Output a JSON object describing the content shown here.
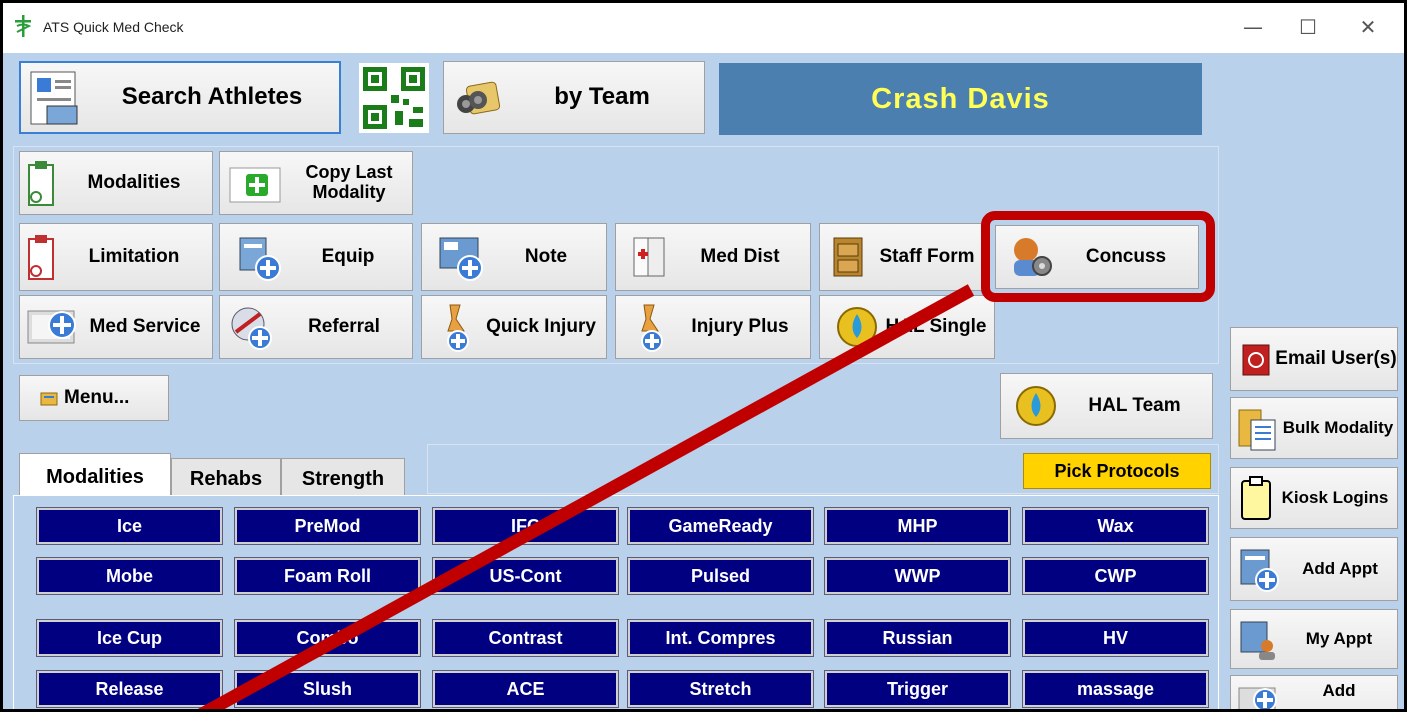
{
  "window": {
    "title": "ATS Quick Med Check",
    "minimize": "—",
    "maximize": "☐",
    "close": "✕"
  },
  "top": {
    "search_athletes": "Search Athletes",
    "by_team": "by Team",
    "athlete_name": "Crash  Davis"
  },
  "actions": {
    "modalities": "Modalities",
    "copy_last_modality": "Copy Last Modality",
    "limitation": "Limitation",
    "equip": "Equip",
    "note": "Note",
    "med_dist": "Med Dist",
    "staff_form": "Staff Form",
    "concuss": "Concuss",
    "med_service": "Med Service",
    "referral": "Referral",
    "quick_injury": "Quick Injury",
    "injury_plus": "Injury Plus",
    "hal_single": "HAL Single",
    "menu": "Menu...",
    "hal_team": "HAL Team"
  },
  "side": {
    "email_users": "Email User(s)",
    "bulk_modality": "Bulk Modality",
    "kiosk_logins": "Kiosk Logins",
    "add_appt": "Add Appt",
    "my_appt": "My Appt",
    "add": "Add"
  },
  "tabs": {
    "modalities": "Modalities",
    "rehabs": "Rehabs",
    "strength": "Strength",
    "pick_protocols": "Pick Protocols"
  },
  "grid": [
    [
      "Ice",
      "PreMod",
      "IFC",
      "GameReady",
      "MHP",
      "Wax"
    ],
    [
      "Mobe",
      "Foam Roll",
      "US-Cont",
      "Pulsed",
      "WWP",
      "CWP"
    ],
    [
      "Ice Cup",
      "Combo",
      "Contrast",
      "Int. Compres",
      "Russian",
      "HV"
    ],
    [
      "Release",
      "Slush",
      "ACE",
      "Stretch",
      "Trigger",
      "massage"
    ]
  ],
  "colors": {
    "highlight": "#c00000",
    "name_bg": "#4a7fb0",
    "name_text": "#ffff55",
    "grid_bg": "#000080",
    "protocol_bg": "#ffd200"
  }
}
